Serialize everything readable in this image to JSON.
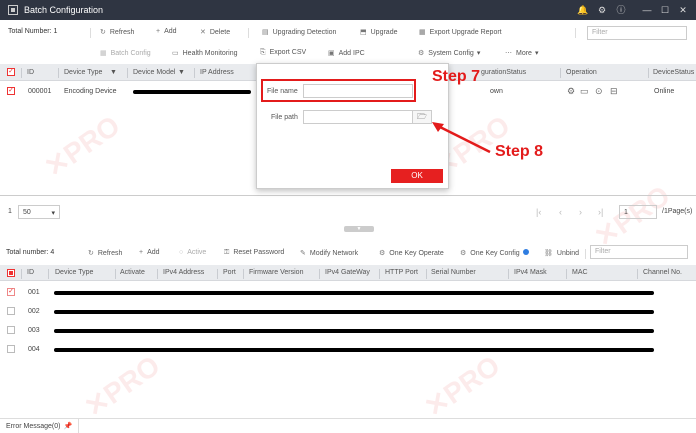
{
  "window": {
    "title": "Batch Configuration",
    "controls": [
      "🔔",
      "⚙",
      "ⓘ",
      "—",
      "☐",
      "✕"
    ]
  },
  "toolbar1": {
    "total": "Total Number: 1",
    "refresh": "Refresh",
    "add": "Add",
    "delete": "Delete",
    "upgrading_detection": "Upgrading Detection",
    "upgrade": "Upgrade",
    "export_upgrade_report": "Export Upgrade Report",
    "filter_placeholder": "Filter"
  },
  "toolbar2": {
    "batch_config": "Batch Config",
    "health_monitoring": "Health Monitoring",
    "export_csv": "Export CSV",
    "add_ipc": "Add IPC",
    "system_config": "System Config",
    "more": "More"
  },
  "table1": {
    "headers": {
      "id": "ID",
      "device_type": "Device Type",
      "device_model": "Device Model",
      "ip_address": "IP Address",
      "configuration_status": "gurationStatus",
      "operation": "Operation",
      "device_status": "DeviceStatus"
    },
    "rows": [
      {
        "id": "000001",
        "device_type": "Encoding Device",
        "status": "own",
        "device_status": "Online"
      }
    ]
  },
  "dialog": {
    "file_name_label": "File name",
    "file_path_label": "File path",
    "ok": "OK"
  },
  "annotations": {
    "step7": "Step 7",
    "step8": "Step 8"
  },
  "pager": {
    "per_page": "50",
    "page": "1",
    "page_total": "/1Page(s)"
  },
  "toolbar3": {
    "total": "Total number: 4",
    "refresh": "Refresh",
    "add": "Add",
    "active": "Active",
    "reset_password": "Reset Password",
    "modify_network": "Modify Network",
    "one_key_operate": "One Key Operate",
    "one_key_config": "One Key Config",
    "unbind": "Unbind",
    "filter_placeholder": "Filter"
  },
  "table2": {
    "headers": {
      "id": "ID",
      "device_type": "Device Type",
      "activate": "Activate",
      "ipv4_address": "IPv4 Address",
      "port": "Port",
      "firmware_version": "Firmware Version",
      "ipv4_gateway": "IPv4 GateWay",
      "http_port": "HTTP Port",
      "serial_number": "Serial Number",
      "ipv4_mask": "IPv4 Mask",
      "mac": "MAC",
      "channel_no": "Channel No."
    },
    "rows": [
      {
        "id": "001"
      },
      {
        "id": "002"
      },
      {
        "id": "003"
      },
      {
        "id": "004"
      }
    ]
  },
  "statusbar": {
    "error_message": "Error Message(0)"
  },
  "colors": {
    "accent_red": "#e31b1b",
    "titlebar": "#2f3542"
  }
}
